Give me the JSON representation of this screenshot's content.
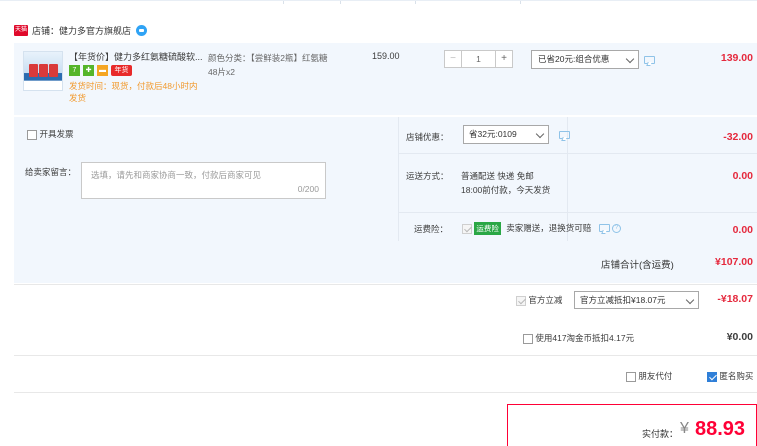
{
  "shop": {
    "badge": "天猫",
    "label": "店铺：",
    "name": "健力多官方旗舰店"
  },
  "item": {
    "title": "【年货价】健力多红氨糖硫酸软...",
    "tag_nian": "年货",
    "tag_seven": "7",
    "ship_info": "发货时间：现货，付款后48小时内发货",
    "sku_line1": "颜色分类：【尝鲜装2瓶】红氨糖",
    "sku_line2": "48片x2",
    "price": "159.00",
    "qty": "1",
    "qty_minus": "−",
    "qty_plus": "+",
    "promo": "已省20元:组合优惠",
    "amount": "139.00"
  },
  "options": {
    "invoice_label": "开具发票",
    "message_label": "给卖家留言：",
    "message_placeholder": "选填，请先和商家协商一致，付款后商家可见",
    "message_count": "0/200",
    "shop_coupon_label": "店铺优惠：",
    "shop_coupon_value": "省32元:0109",
    "shop_coupon_amount": "-32.00",
    "delivery_label": "运送方式：",
    "delivery_line1": "普通配送 快递 免邮",
    "delivery_line2": "18:00前付款，今天发货",
    "delivery_amount": "0.00",
    "insurance_label": "运费险：",
    "insurance_badge": "运费险",
    "insurance_text": "卖家赠送，退换货可赔",
    "insurance_amount": "0.00"
  },
  "shop_total": {
    "label": "店铺合计(含运费)",
    "amount": "¥107.00"
  },
  "discounts": {
    "official_label": "官方立减",
    "official_select": "官方立减抵扣¥18.07元",
    "official_amount": "-¥18.07",
    "coins_label": "使用417淘金币抵扣4.17元",
    "coins_amount": "¥0.00",
    "friend_pay_label": "朋友代付",
    "anonymous_label": "匿名购买"
  },
  "payment": {
    "label": "实付款：",
    "currency": "¥",
    "amount": "88.93"
  },
  "colors": {
    "accent_red": "#ff0036",
    "row_bg": "#f2f7fd"
  }
}
